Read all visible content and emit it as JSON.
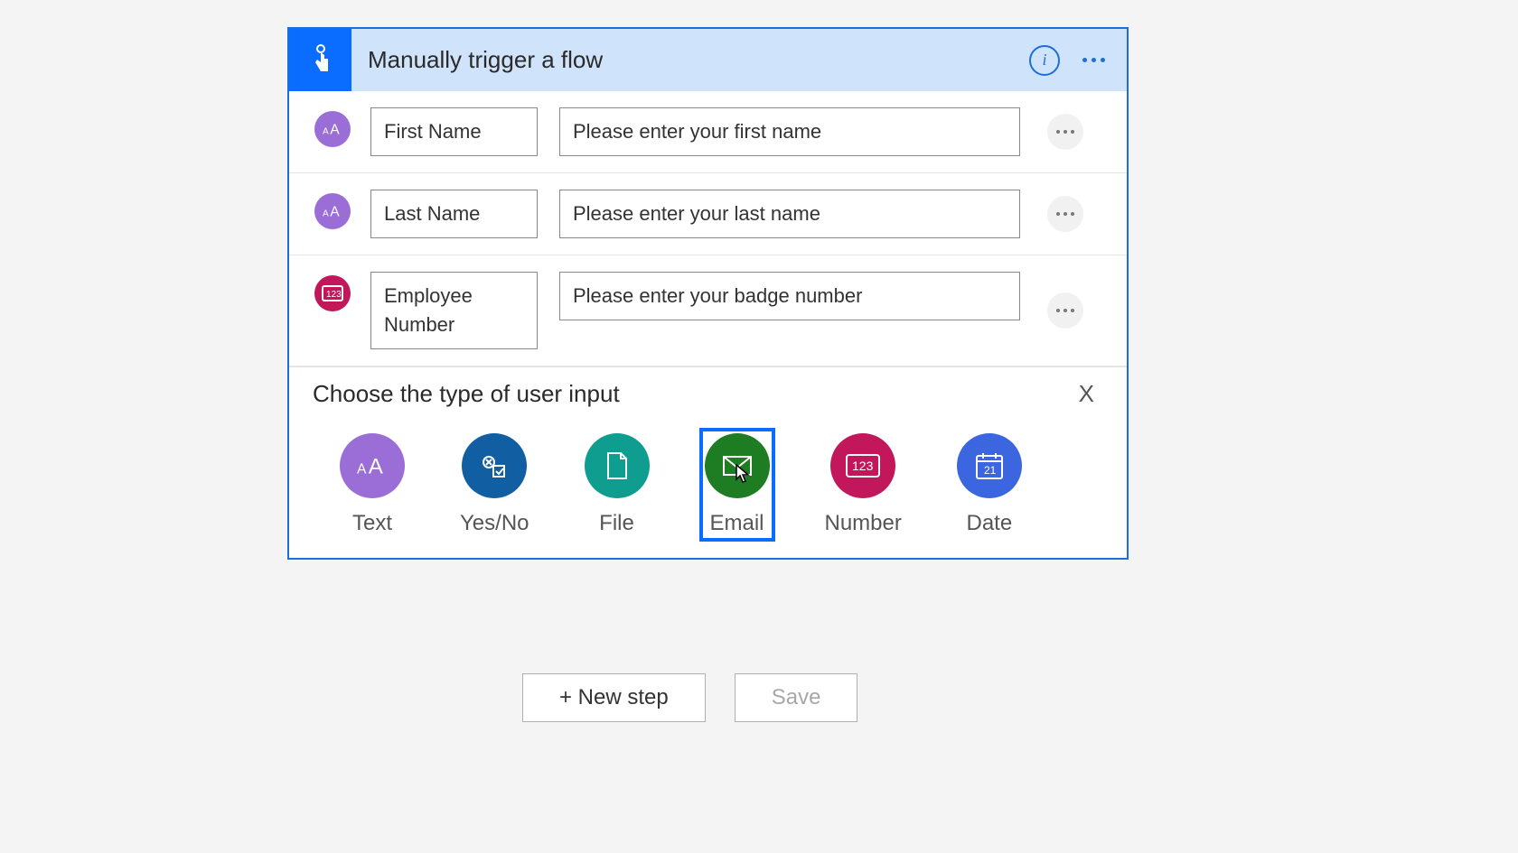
{
  "card": {
    "title": "Manually trigger a flow",
    "inputs": [
      {
        "icon": "text",
        "label": "First Name",
        "hint": "Please enter your first name"
      },
      {
        "icon": "text",
        "label": "Last Name",
        "hint": "Please enter your last name"
      },
      {
        "icon": "number",
        "label": "Employee Number",
        "hint": "Please enter your badge number"
      }
    ]
  },
  "picker": {
    "title": "Choose the type of user input",
    "close": "X",
    "types": [
      {
        "label": "Text"
      },
      {
        "label": "Yes/No"
      },
      {
        "label": "File"
      },
      {
        "label": "Email"
      },
      {
        "label": "Number"
      },
      {
        "label": "Date"
      }
    ],
    "selected_index": 3
  },
  "actions": {
    "new_step": "+ New step",
    "save": "Save"
  }
}
